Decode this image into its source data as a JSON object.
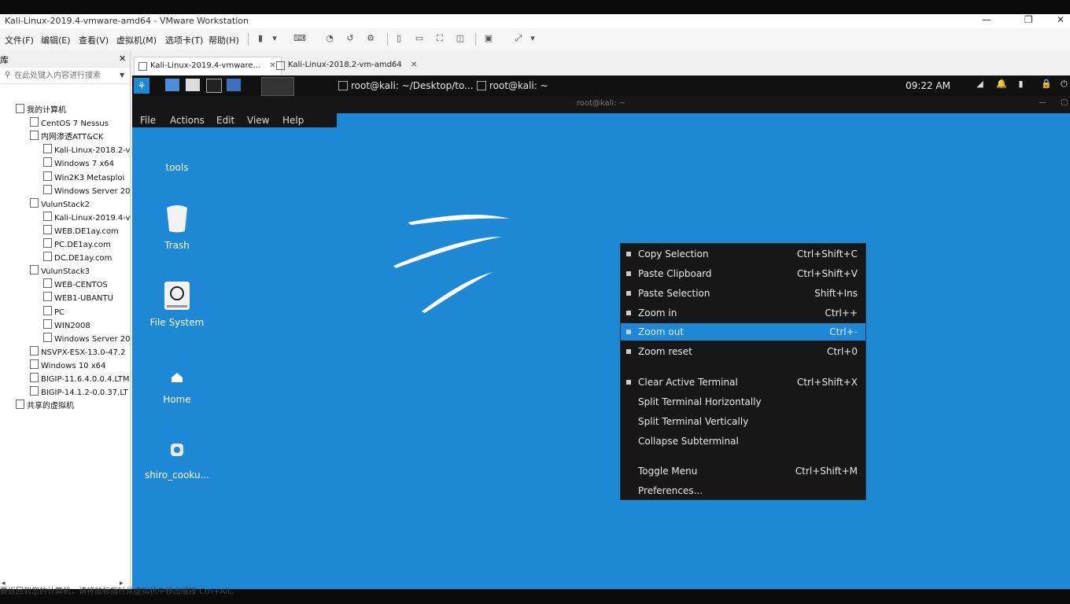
{
  "window": {
    "title": "Kali-Linux-2019.4-vmware-amd64 - VMware Workstation",
    "controls": [
      "—",
      "❐",
      "✕"
    ]
  },
  "menu": [
    "文件(F)",
    "编辑(E)",
    "查看(V)",
    "虚拟机(M)",
    "选项卡(T)",
    "帮助(H)"
  ],
  "library": {
    "title": "库",
    "close": "✕",
    "search_placeholder": "在此处键入内容进行搜索",
    "tree": [
      {
        "label": "我的计算机",
        "level": 0
      },
      {
        "label": "CentOS 7 Nessus",
        "level": 1
      },
      {
        "label": "内网渗透ATT&CK",
        "level": 1
      },
      {
        "label": "Kali-Linux-2018.2-v",
        "level": 2
      },
      {
        "label": "Windows 7 x64",
        "level": 2
      },
      {
        "label": "Win2K3 Metasploi",
        "level": 2
      },
      {
        "label": "Windows Server 20",
        "level": 2
      },
      {
        "label": "VulunStack2",
        "level": 1
      },
      {
        "label": "Kali-Linux-2019.4-v",
        "level": 2
      },
      {
        "label": "WEB.DE1ay.com",
        "level": 2
      },
      {
        "label": "PC.DE1ay.com",
        "level": 2
      },
      {
        "label": "DC.DE1ay.com",
        "level": 2
      },
      {
        "label": "VulunStack3",
        "level": 1
      },
      {
        "label": "WEB-CENTOS",
        "level": 2
      },
      {
        "label": "WEB1-UBANTU",
        "level": 2
      },
      {
        "label": "PC",
        "level": 2
      },
      {
        "label": "WIN2008",
        "level": 2
      },
      {
        "label": "Windows Server 20",
        "level": 2
      },
      {
        "label": "NSVPX-ESX-13.0-47.2",
        "level": 1
      },
      {
        "label": "Windows 10 x64",
        "level": 1
      },
      {
        "label": "BIGIP-11.6.4.0.0.4.LTM",
        "level": 1
      },
      {
        "label": "BIGIP-14.1.2-0.0.37.LT",
        "level": 1
      },
      {
        "label": "共享的虚拟机",
        "level": 0
      }
    ]
  },
  "tabs": [
    {
      "label": "Kali-Linux-2019.4-vmware...",
      "active": true
    },
    {
      "label": "Kali-Linux-2018.2-vm-amd64",
      "active": false
    }
  ],
  "kali": {
    "panel": {
      "tasks": [
        "root@kali: ~/Desktop/to...",
        "root@kali: ~"
      ],
      "clock": "09:22 AM"
    },
    "terminal_title": "root@kali: ~",
    "terminal_menu": [
      "File",
      "Actions",
      "Edit",
      "View",
      "Help"
    ],
    "desktop_icons": [
      {
        "label": "tools",
        "icon": "folder-icon"
      },
      {
        "label": "Trash",
        "icon": "trash-icon"
      },
      {
        "label": "File System",
        "icon": "drive-icon"
      },
      {
        "label": "Home",
        "icon": "home-icon"
      },
      {
        "label": "shiro_cooku...",
        "icon": "python-file-icon"
      }
    ],
    "context_menu": [
      {
        "label": "Copy Selection",
        "shortcut": "Ctrl+Shift+C"
      },
      {
        "label": "Paste Clipboard",
        "shortcut": "Ctrl+Shift+V"
      },
      {
        "label": "Paste Selection",
        "shortcut": "Shift+Ins"
      },
      {
        "label": "Zoom in",
        "shortcut": "Ctrl++"
      },
      {
        "label": "Zoom out",
        "shortcut": "Ctrl+-"
      },
      {
        "label": "Zoom reset",
        "shortcut": "Ctrl+0"
      },
      {
        "label": "Clear Active Terminal",
        "shortcut": "Ctrl+Shift+X"
      },
      {
        "label": "Split Terminal Horizontally",
        "shortcut": ""
      },
      {
        "label": "Split Terminal Vertically",
        "shortcut": ""
      },
      {
        "label": "Collapse Subterminal",
        "shortcut": ""
      },
      {
        "label": "Toggle Menu",
        "shortcut": "Ctrl+Shift+M"
      },
      {
        "label": "Preferences...",
        "shortcut": ""
      }
    ]
  },
  "status": "要返回到您的计算机，请将鼠标指针从虚拟机中移出或按 Ctrl+Alt。",
  "colors": {
    "desktop": "#1c88d6",
    "panel": "#111111",
    "menu_bg": "#171717",
    "highlight": "#1c88d6"
  }
}
